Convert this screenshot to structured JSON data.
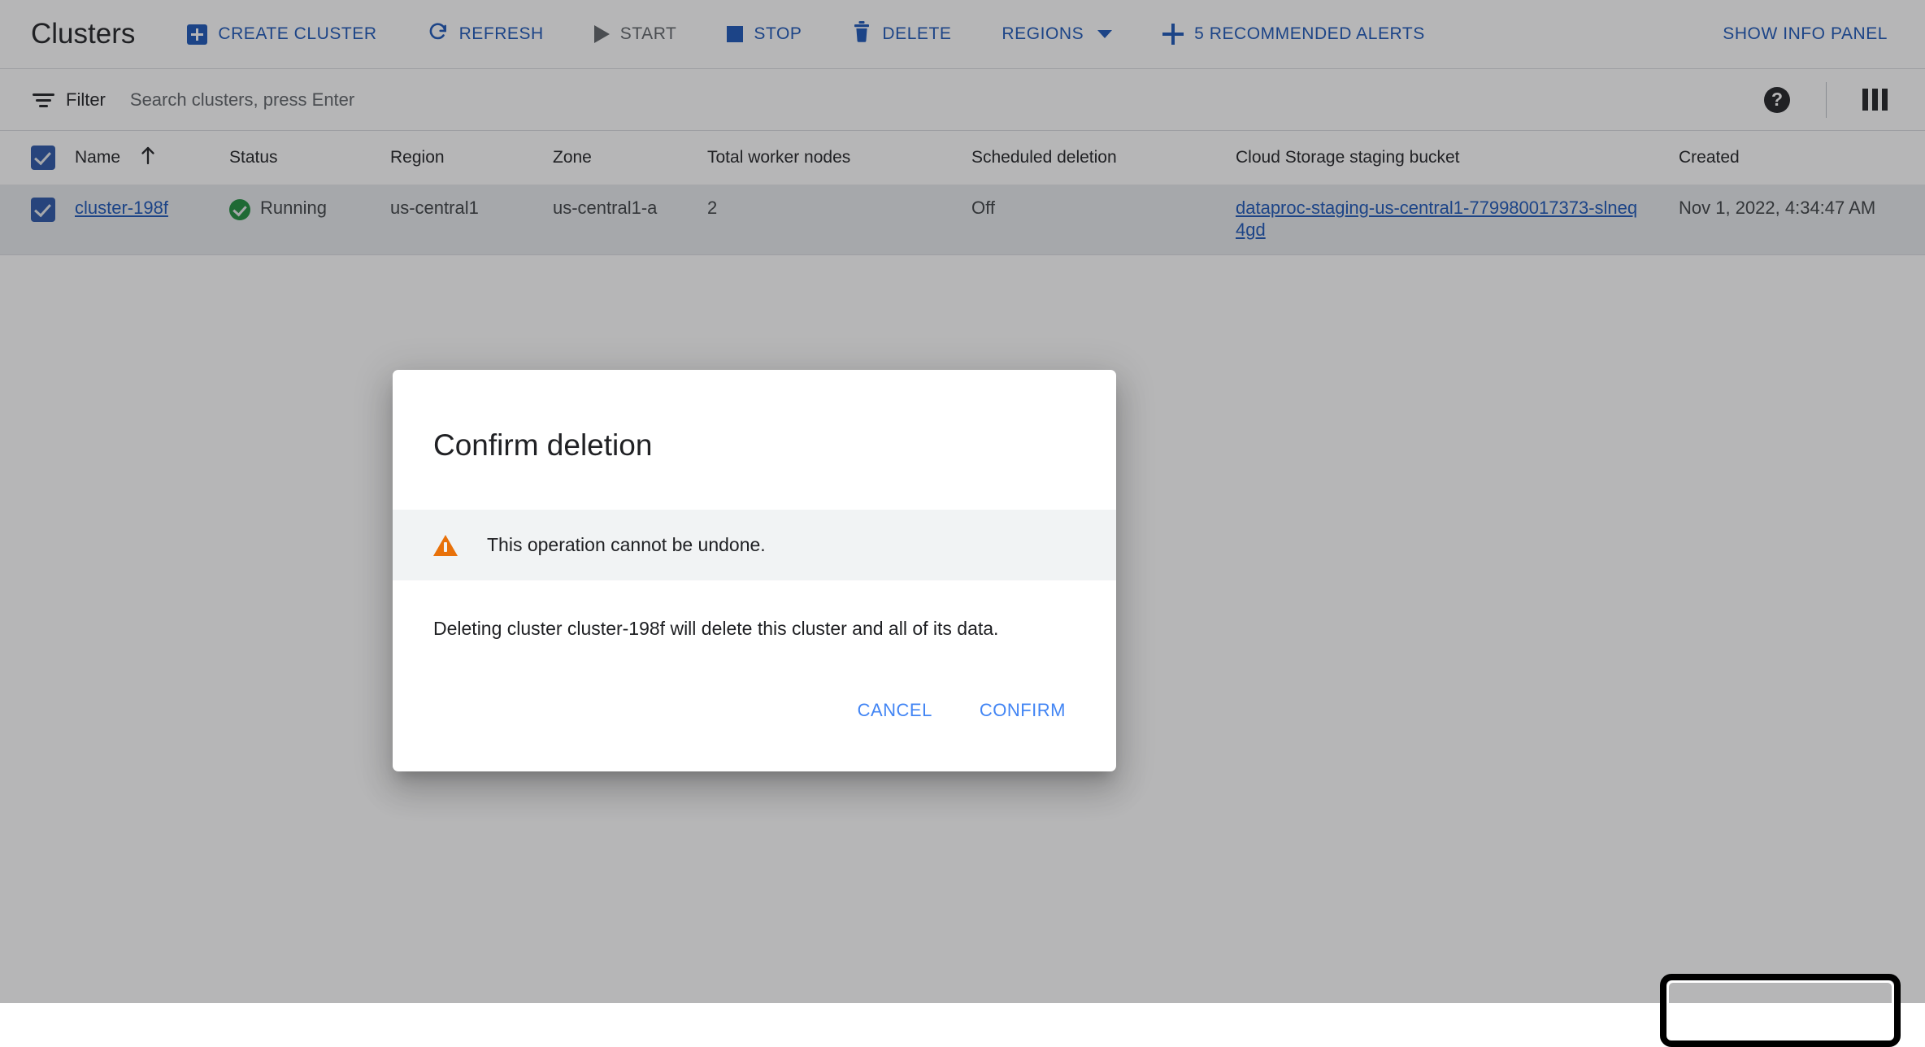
{
  "header": {
    "title": "Clusters",
    "actions": [
      {
        "label": "CREATE CLUSTER",
        "icon": "plus-box-icon",
        "disabled": false
      },
      {
        "label": "REFRESH",
        "icon": "refresh-icon",
        "disabled": false
      },
      {
        "label": "START",
        "icon": "play-icon",
        "disabled": true
      },
      {
        "label": "STOP",
        "icon": "stop-icon",
        "disabled": false
      },
      {
        "label": "DELETE",
        "icon": "trash-icon",
        "disabled": false
      },
      {
        "label": "REGIONS",
        "icon": "chevron-down-icon",
        "disabled": false
      },
      {
        "label": "5 RECOMMENDED ALERTS",
        "icon": "plus-icon",
        "disabled": false
      }
    ],
    "info_panel_label": "SHOW INFO PANEL"
  },
  "filter_bar": {
    "filter_label": "Filter",
    "search_placeholder": "Search clusters, press Enter",
    "search_value": "",
    "help_icon": "help-icon",
    "columns_icon": "column-settings-icon"
  },
  "table": {
    "select_all_checked": true,
    "sort_column": "Name",
    "sort_direction": "asc",
    "columns": [
      "Name",
      "Status",
      "Region",
      "Zone",
      "Total worker nodes",
      "Scheduled deletion",
      "Cloud Storage staging bucket",
      "Created"
    ],
    "rows": [
      {
        "selected": true,
        "name": "cluster-198f",
        "status": "Running",
        "status_icon": "check-circle-icon",
        "region": "us-central1",
        "zone": "us-central1-a",
        "total_worker_nodes": "2",
        "scheduled_deletion": "Off",
        "staging_bucket": "dataproc-staging-us-central1-779980017373-slneq4gd",
        "created": "Nov 1, 2022, 4:34:47 AM"
      }
    ]
  },
  "dialog": {
    "title": "Confirm deletion",
    "warning_icon": "warning-triangle-icon",
    "warning_text": "This operation cannot be undone.",
    "body_text": "Deleting cluster cluster-198f will delete this cluster and all of its data.",
    "cancel_label": "CANCEL",
    "confirm_label": "CONFIRM"
  },
  "colors": {
    "link_blue": "#1a56b8",
    "action_blue": "#4285f4",
    "disabled_grey": "#5f6368",
    "status_green": "#1e8e3e",
    "warning_orange": "#e8710a",
    "banner_grey": "#f1f3f4",
    "row_grey": "#e8eaed"
  }
}
